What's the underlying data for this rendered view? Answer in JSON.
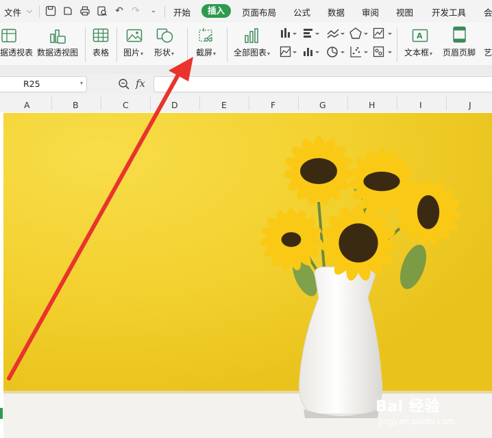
{
  "menubar": {
    "file_menu": "文件",
    "tabs": [
      "开始",
      "插入",
      "页面布局",
      "公式",
      "数据",
      "审阅",
      "视图",
      "开发工具",
      "会"
    ],
    "active_tab": "插入"
  },
  "ribbon": {
    "pivot_table": "据透视表",
    "pivot_chart": "数据透视图",
    "table": "表格",
    "picture": "图片",
    "shape": "形状",
    "screenshot": "截屏",
    "all_charts": "全部图表",
    "textbox": "文本框",
    "header_footer": "页眉页脚",
    "art_text": "艺"
  },
  "formula_bar": {
    "cell_ref": "R25",
    "fx": "fx",
    "formula_value": ""
  },
  "columns": [
    "A",
    "B",
    "C",
    "D",
    "E",
    "F",
    "G",
    "H",
    "I",
    "J"
  ],
  "watermark": {
    "brand": "Bai  经验",
    "url": "jingyan.baidu.com"
  },
  "colors": {
    "accent_green": "#2d9a4d",
    "arrow_red": "#e8342c",
    "photo_yellow": "#f2cf2c"
  },
  "icons": [
    "chevron-down-icon",
    "save-icon",
    "print-icon",
    "print-preview-icon",
    "undo-icon",
    "redo-icon",
    "zoom-icon",
    "screenshot-icon"
  ]
}
